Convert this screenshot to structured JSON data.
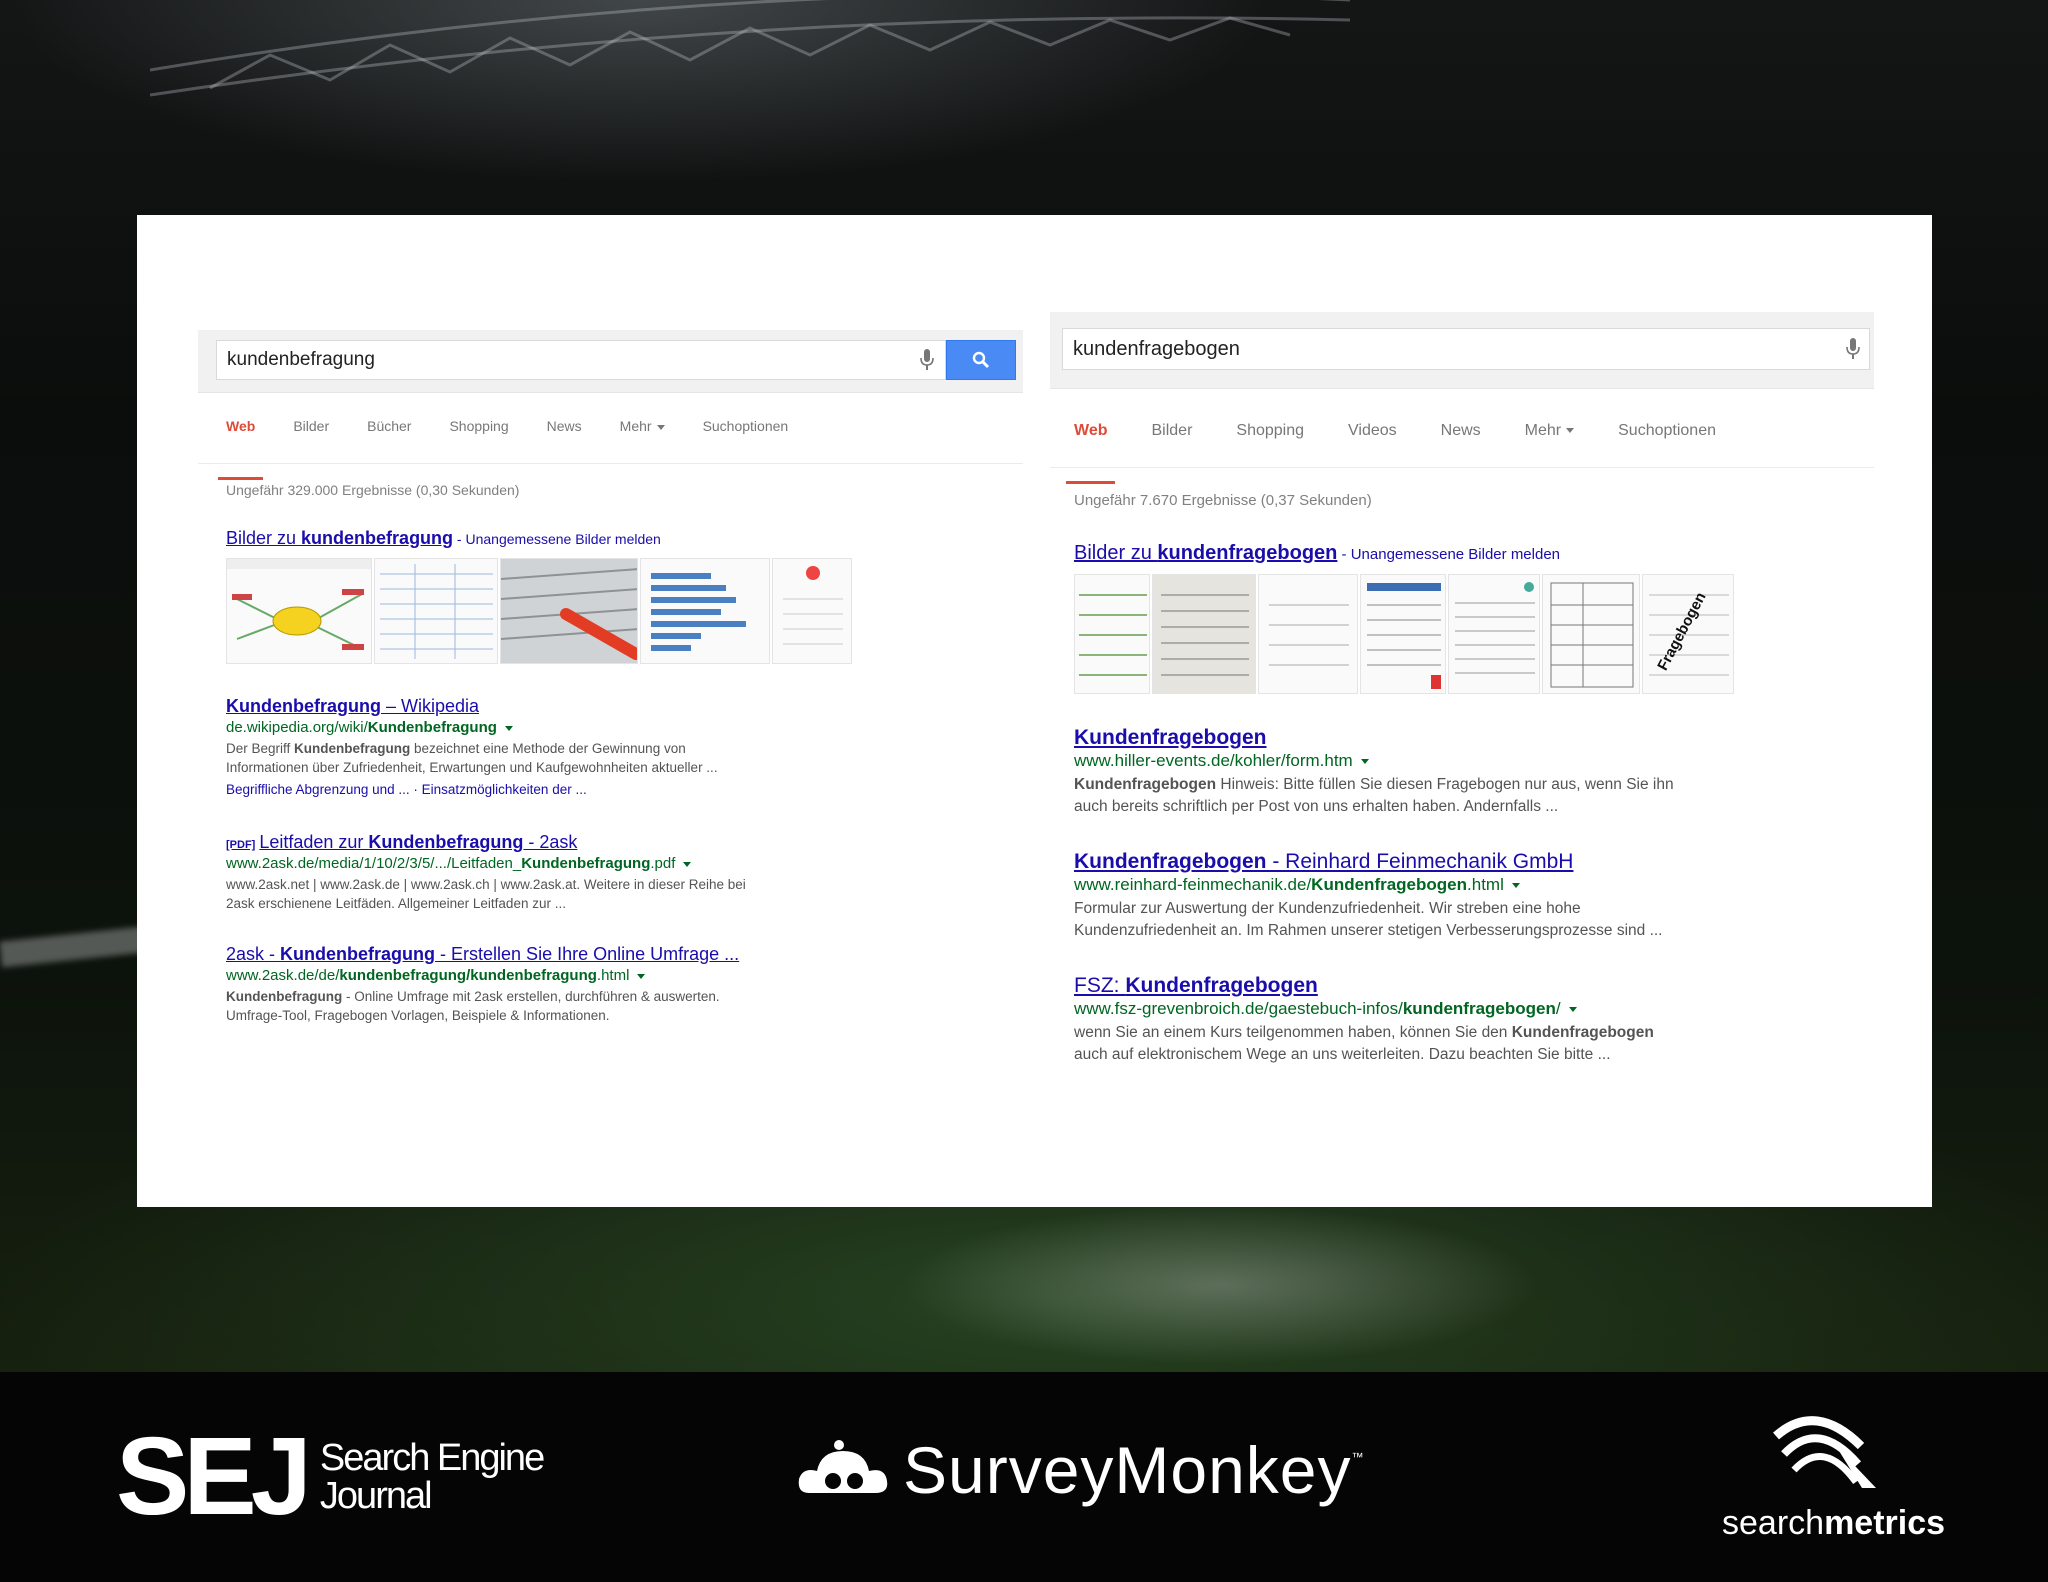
{
  "left": {
    "query": "kundenbefragung",
    "tabs": [
      {
        "label": "Web",
        "active": true
      },
      {
        "label": "Bilder",
        "active": false
      },
      {
        "label": "Bücher",
        "active": false
      },
      {
        "label": "Shopping",
        "active": false
      },
      {
        "label": "News",
        "active": false
      },
      {
        "label": "Mehr",
        "active": false,
        "dropdown": true
      },
      {
        "label": "Suchoptionen",
        "active": false
      }
    ],
    "stats": "Ungefähr 329.000 Ergebnisse (0,30 Sekunden)",
    "images_title_prefix": "Bilder zu ",
    "images_title_keyword": "kundenbefragung",
    "images_report": " - Unangemessene Bilder melden",
    "results": [
      {
        "title_bold": "Kundenbefragung",
        "title_rest": " – Wikipedia",
        "url_plain": "de.wikipedia.org/wiki/",
        "url_bold": "Kundenbefragung",
        "url_rest": "",
        "snippet_1_pre": "Der Begriff ",
        "snippet_1_bold": "Kundenbefragung",
        "snippet_1_post": " bezeichnet eine Methode der Gewinnung von",
        "snippet_2": "Informationen über Zufriedenheit, Erwartungen und Kaufgewohnheiten aktueller ...",
        "sitelinks": "Begriffliche Abgrenzung und ... · Einsatzmöglichkeiten der ..."
      },
      {
        "pdf_tag": "[PDF]",
        "title_plain": "Leitfaden zur ",
        "title_bold": "Kundenbefragung",
        "title_rest": " - 2ask",
        "url_plain": "www.2ask.de/media/1/10/2/3/5/.../Leitfaden_",
        "url_bold": "Kundenbefragung",
        "url_rest": ".pdf",
        "snippet_1": "www.2ask.net | www.2ask.de | www.2ask.ch | www.2ask.at. Weitere in dieser Reihe bei",
        "snippet_2": "2ask erschienene Leitfäden. Allgemeiner Leitfaden zur ..."
      },
      {
        "title_plain": "2ask - ",
        "title_bold": "Kundenbefragung",
        "title_rest": " - Erstellen Sie Ihre Online Umfrage ...",
        "url_plain": "www.2ask.de/de/",
        "url_bold": "kundenbefragung/kundenbefragung",
        "url_rest": ".html",
        "snippet_1_bold": "Kundenbefragung",
        "snippet_1_post": " - Online Umfrage mit 2ask erstellen, durchführen & auswerten.",
        "snippet_2": "Umfrage-Tool, Fragebogen Vorlagen, Beispiele & Informationen."
      }
    ]
  },
  "right": {
    "query": "kundenfragebogen",
    "tabs": [
      {
        "label": "Web",
        "active": true
      },
      {
        "label": "Bilder",
        "active": false
      },
      {
        "label": "Shopping",
        "active": false
      },
      {
        "label": "Videos",
        "active": false
      },
      {
        "label": "News",
        "active": false
      },
      {
        "label": "Mehr",
        "active": false,
        "dropdown": true
      },
      {
        "label": "Suchoptionen",
        "active": false
      }
    ],
    "stats": "Ungefähr 7.670 Ergebnisse (0,37 Sekunden)",
    "images_title_prefix": "Bilder zu ",
    "images_title_keyword": "kundenfragebogen",
    "images_report": " - Unangemessene Bilder melden",
    "thumb_text": "Fragebogen",
    "results": [
      {
        "title_bold": "Kundenfragebogen",
        "title_rest": "",
        "url_plain": "www.hiller-events.de/kohler/form.htm",
        "url_bold": "",
        "url_rest": "",
        "snippet_1_bold": "Kundenfragebogen",
        "snippet_1_post": " Hinweis: Bitte füllen Sie diesen Fragebogen nur aus, wenn Sie ihn",
        "snippet_2": "auch bereits schriftlich per Post von uns erhalten haben. Andernfalls ..."
      },
      {
        "title_bold": "Kundenfragebogen",
        "title_rest": " - Reinhard Feinmechanik GmbH",
        "url_plain": "www.reinhard-feinmechanik.de/",
        "url_bold": "Kundenfragebogen",
        "url_rest": ".html",
        "snippet_1": "Formular zur Auswertung der Kundenzufriedenheit. Wir streben eine hohe",
        "snippet_2": "Kundenzufriedenheit an. Im Rahmen unserer stetigen Verbesserungsprozesse sind ..."
      },
      {
        "title_plain": "FSZ: ",
        "title_bold": "Kundenfragebogen",
        "title_rest": "",
        "url_plain": "www.fsz-grevenbroich.de/gaestebuch-infos/",
        "url_bold": "kundenfragebogen",
        "url_rest": "/",
        "snippet_1_pre": "wenn Sie an einem Kurs teilgenommen haben, können Sie den ",
        "snippet_1_bold": "Kundenfragebogen",
        "snippet_2": "auch auf elektronischem Wege an uns weiterleiten. Dazu beachten Sie bitte ..."
      }
    ]
  },
  "footer": {
    "sej_mark": "SEJ",
    "sej_line1": "Search Engine",
    "sej_line2": "Journal",
    "surveymonkey": "SurveyMonkey",
    "surveymonkey_tm": "™",
    "searchmetrics_light": "search",
    "searchmetrics_bold": "metrics"
  },
  "colors": {
    "link": "#1a0dab",
    "url_green": "#006621",
    "active_tab_red": "#dd4b39",
    "search_blue": "#4a8af4"
  },
  "icons": [
    "microphone-icon",
    "search-icon",
    "surveymonkey-cloud-icon",
    "searchmetrics-wave-icon"
  ]
}
